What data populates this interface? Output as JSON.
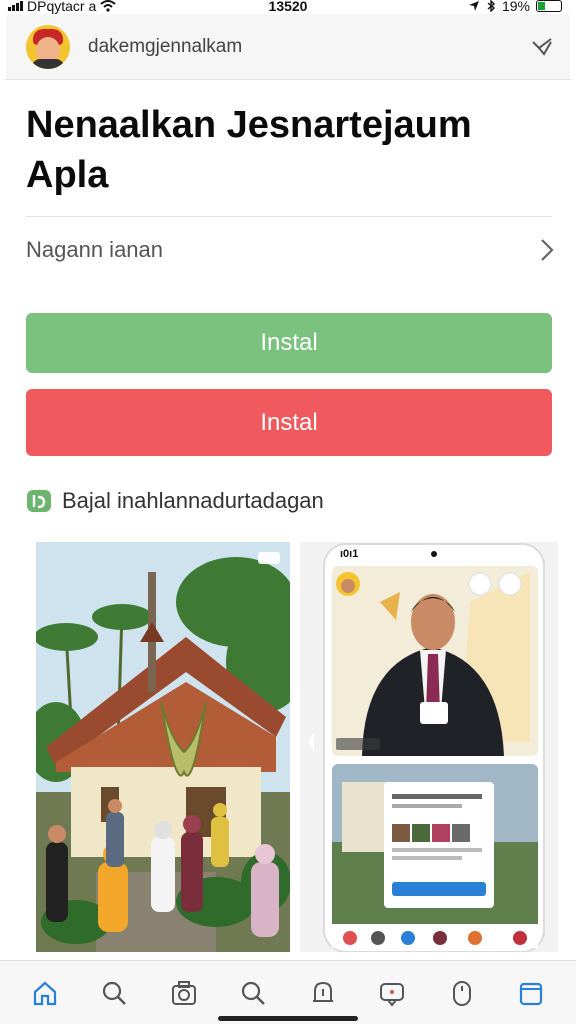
{
  "status_bar": {
    "carrier": "DPqytacr a",
    "time": "13520",
    "battery": "19%",
    "battery_level": 0.19
  },
  "header": {
    "username": "dakemgjennalkam"
  },
  "main": {
    "title": "Nenaalkan Jesnartejaum Apla",
    "nav_row_label": "Nagann ianan",
    "install_primary": "Instal",
    "install_secondary": "Instal",
    "section_label": "Bajal inahlannadurtadagan"
  },
  "phone_mock": {
    "time": "ı0ı1"
  },
  "bottom_nav": {
    "items": [
      {
        "icon": "home-icon"
      },
      {
        "icon": "search-icon"
      },
      {
        "icon": "camera-icon"
      },
      {
        "icon": "search-icon"
      },
      {
        "icon": "notification-icon"
      },
      {
        "icon": "message-icon"
      },
      {
        "icon": "mouse-icon"
      },
      {
        "icon": "window-icon"
      }
    ]
  },
  "colors": {
    "install_green": "#7cc27f",
    "install_red": "#f05a5f",
    "accent_blue": "#2a7fd6"
  }
}
